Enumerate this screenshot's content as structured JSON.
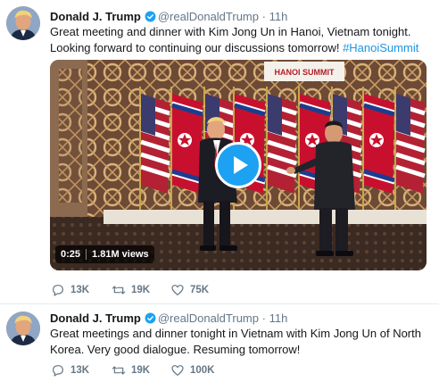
{
  "tweets": [
    {
      "name": "Donald J. Trump",
      "handle": "@realDonaldTrump",
      "dot": "·",
      "time": "11h",
      "text_main": "Great meeting and dinner with Kim Jong Un in Hanoi, Vietnam tonight. Looking forward to continuing our discussions tomorrow! ",
      "hashtag": "#HanoiSummit",
      "video": {
        "duration": "0:25",
        "views": "1.81M views",
        "backdrop_sign": "HANOI SUMMIT"
      },
      "replies": "13K",
      "retweets": "19K",
      "likes": "75K"
    },
    {
      "name": "Donald J. Trump",
      "handle": "@realDonaldTrump",
      "dot": "·",
      "time": "11h",
      "text_main": "Great meetings and dinner tonight in Vietnam with Kim Jong Un of North Korea. Very good dialogue. Resuming tomorrow!",
      "replies": "13K",
      "retweets": "19K",
      "likes": "100K"
    }
  ],
  "colors": {
    "link": "#1b95e0",
    "verified": "#1da1f2",
    "muted": "#657786",
    "divider": "#e6ecf0"
  },
  "icons": [
    "verified-badge-icon",
    "reply-icon",
    "retweet-icon",
    "like-icon",
    "play-icon"
  ]
}
